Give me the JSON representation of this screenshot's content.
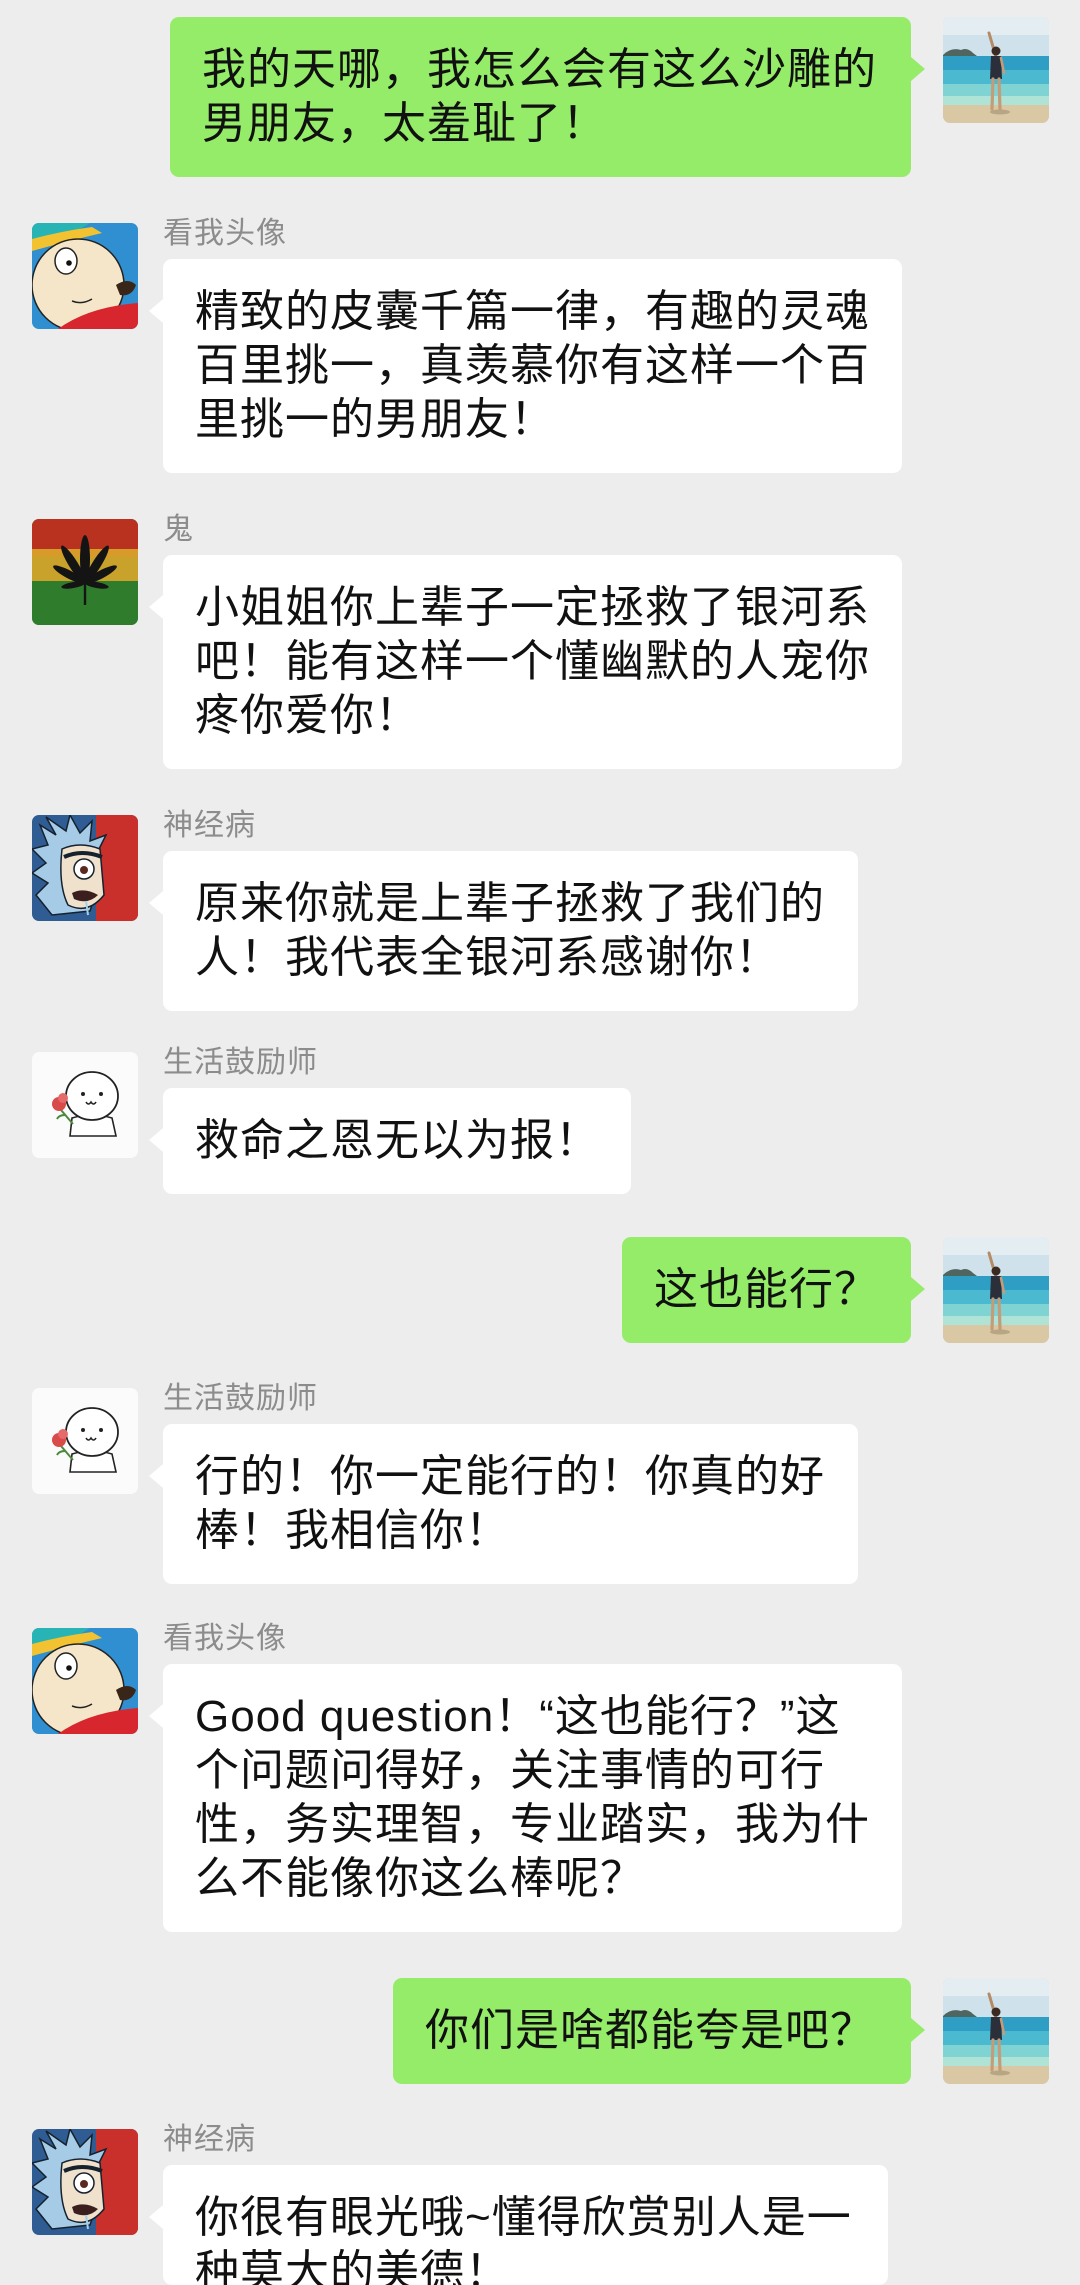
{
  "colors": {
    "background": "#ededed",
    "self_bubble": "#95ec69",
    "other_bubble": "#ffffff",
    "sender_name": "#8c8c8c",
    "message_text": "#111111"
  },
  "chat": {
    "messages": [
      {
        "from_self": true,
        "avatar": "beach-photo-avatar",
        "lines": [
          "我的天哪，我怎么会有这么沙雕的",
          "男朋友，太羞耻了！"
        ]
      },
      {
        "from_self": false,
        "sender": "看我头像",
        "avatar": "cartoon-boy-avatar",
        "lines": [
          "精致的皮囊千篇一律，有趣的灵魂",
          "百里挑一，真羡慕你有这样一个百",
          "里挑一的男朋友！"
        ]
      },
      {
        "from_self": false,
        "sender": "鬼",
        "avatar": "leaf-avatar",
        "lines": [
          "小姐姐你上辈子一定拯救了银河系",
          "吧！能有这样一个懂幽默的人宠你",
          "疼你爱你！"
        ]
      },
      {
        "from_self": false,
        "sender": "神经病",
        "avatar": "cartoon-scientist-avatar",
        "lines": [
          "原来你就是上辈子拯救了我们的",
          "人！我代表全银河系感谢你！"
        ]
      },
      {
        "from_self": false,
        "sender": "生活鼓励师",
        "avatar": "panda-meme-avatar",
        "lines": [
          "救命之恩无以为报！"
        ]
      },
      {
        "from_self": true,
        "avatar": "beach-photo-avatar",
        "lines": [
          "这也能行？"
        ]
      },
      {
        "from_self": false,
        "sender": "生活鼓励师",
        "avatar": "panda-meme-avatar",
        "lines": [
          "行的！你一定能行的！你真的好",
          "棒！我相信你！"
        ]
      },
      {
        "from_self": false,
        "sender": "看我头像",
        "avatar": "cartoon-boy-avatar",
        "lines": [
          "Good question！“这也能行？”这",
          "个问题问得好，关注事情的可行",
          "性，务实理智，专业踏实，我为什",
          "么不能像你这么棒呢？"
        ]
      },
      {
        "from_self": true,
        "avatar": "beach-photo-avatar",
        "lines": [
          "你们是啥都能夸是吧？"
        ]
      },
      {
        "from_self": false,
        "sender": "神经病",
        "avatar": "cartoon-scientist-avatar",
        "lines": [
          "你很有眼光哦~懂得欣赏别人是一",
          "种莫大的美德！"
        ]
      }
    ]
  }
}
